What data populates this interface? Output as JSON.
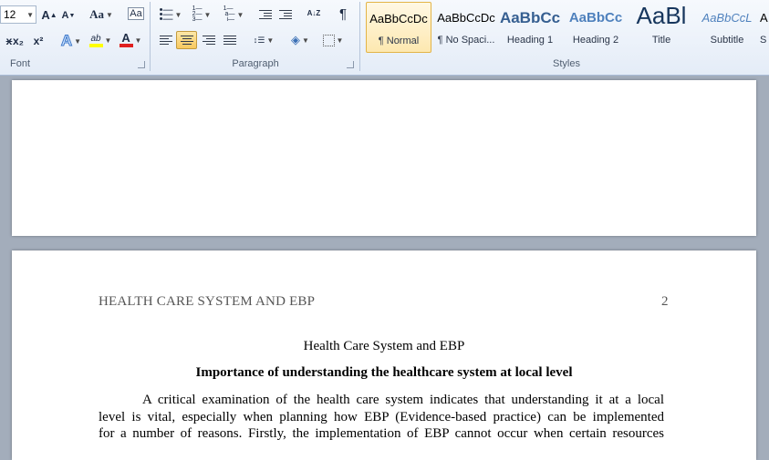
{
  "ribbon": {
    "font_group": {
      "label": "Font",
      "font_size": "12",
      "grow_glyph": "A",
      "shrink_glyph": "A",
      "change_case": "Aa",
      "clear_glyph": "Aa",
      "subscript": "x₂",
      "superscript": "x²",
      "text_effects_glyph": "A",
      "highlight_glyph": "ab",
      "font_color_glyph": "A",
      "highlight_color": "#ffff00",
      "font_color": "#e02020"
    },
    "paragraph_group": {
      "label": "Paragraph",
      "sort_glyph": "A↓Z",
      "pilcrow": "¶"
    },
    "styles_group": {
      "label": "Styles",
      "items": [
        {
          "sample": "AaBbCcDc",
          "name": "¶ Normal",
          "color": "#000000"
        },
        {
          "sample": "AaBbCcDc",
          "name": "¶ No Spaci...",
          "color": "#000000"
        },
        {
          "sample": "AaBbCc",
          "name": "Heading 1",
          "color": "#365f91"
        },
        {
          "sample": "AaBbCc",
          "name": "Heading 2",
          "color": "#4f81bd"
        },
        {
          "sample": "AaBl",
          "name": "Title",
          "color": "#17365d"
        },
        {
          "sample": "AaBbCcL",
          "name": "Subtitle",
          "color": "#4f81bd"
        },
        {
          "sample": "A",
          "name": "S",
          "color": "#000000"
        }
      ]
    }
  },
  "document": {
    "running_head": "HEALTH CARE SYSTEM AND EBP",
    "page_number": "2",
    "title": "Health Care System and EBP",
    "heading": "Importance of understanding the healthcare system  at local level",
    "paragraph_lines": [
      "A critical examination of the health care system indicates that understanding it at a local",
      "level is vital, especially  when planning how EBP (Evidence-based practice) can be implemented",
      "for a number of reasons. Firstly, the implementation  of EBP cannot occur when certain resources"
    ]
  }
}
